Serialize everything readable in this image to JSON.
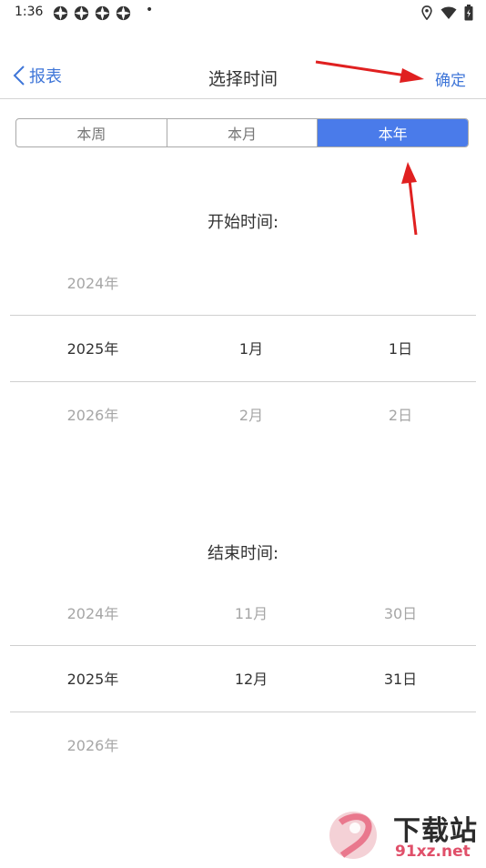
{
  "status_bar": {
    "time": "1:36",
    "dot": "•",
    "notification_icons": [
      "app-notification-icon",
      "app-notification-icon",
      "app-notification-icon",
      "app-notification-icon"
    ],
    "system_icons": [
      "location-icon",
      "wifi-icon",
      "battery-icon"
    ]
  },
  "nav": {
    "back_label": "报表",
    "title": "选择时间",
    "confirm_label": "确定"
  },
  "range_tabs": [
    {
      "label": "本周",
      "selected": false
    },
    {
      "label": "本月",
      "selected": false
    },
    {
      "label": "本年",
      "selected": true
    }
  ],
  "start_picker": {
    "label": "开始时间:",
    "rows": [
      {
        "year": "2024年",
        "month": "",
        "day": ""
      },
      {
        "year": "2025年",
        "month": "1月",
        "day": "1日"
      },
      {
        "year": "2026年",
        "month": "2月",
        "day": "2日"
      }
    ]
  },
  "end_picker": {
    "label": "结束时间:",
    "rows": [
      {
        "year": "2024年",
        "month": "11月",
        "day": "30日"
      },
      {
        "year": "2025年",
        "month": "12月",
        "day": "31日"
      },
      {
        "year": "2026年",
        "month": "",
        "day": ""
      }
    ]
  },
  "colors": {
    "accent": "#4a7bea",
    "link": "#3f76d8",
    "annotation_arrow": "#e02020"
  },
  "watermark": {
    "text": "下载站",
    "url_text": "91xz.net"
  }
}
